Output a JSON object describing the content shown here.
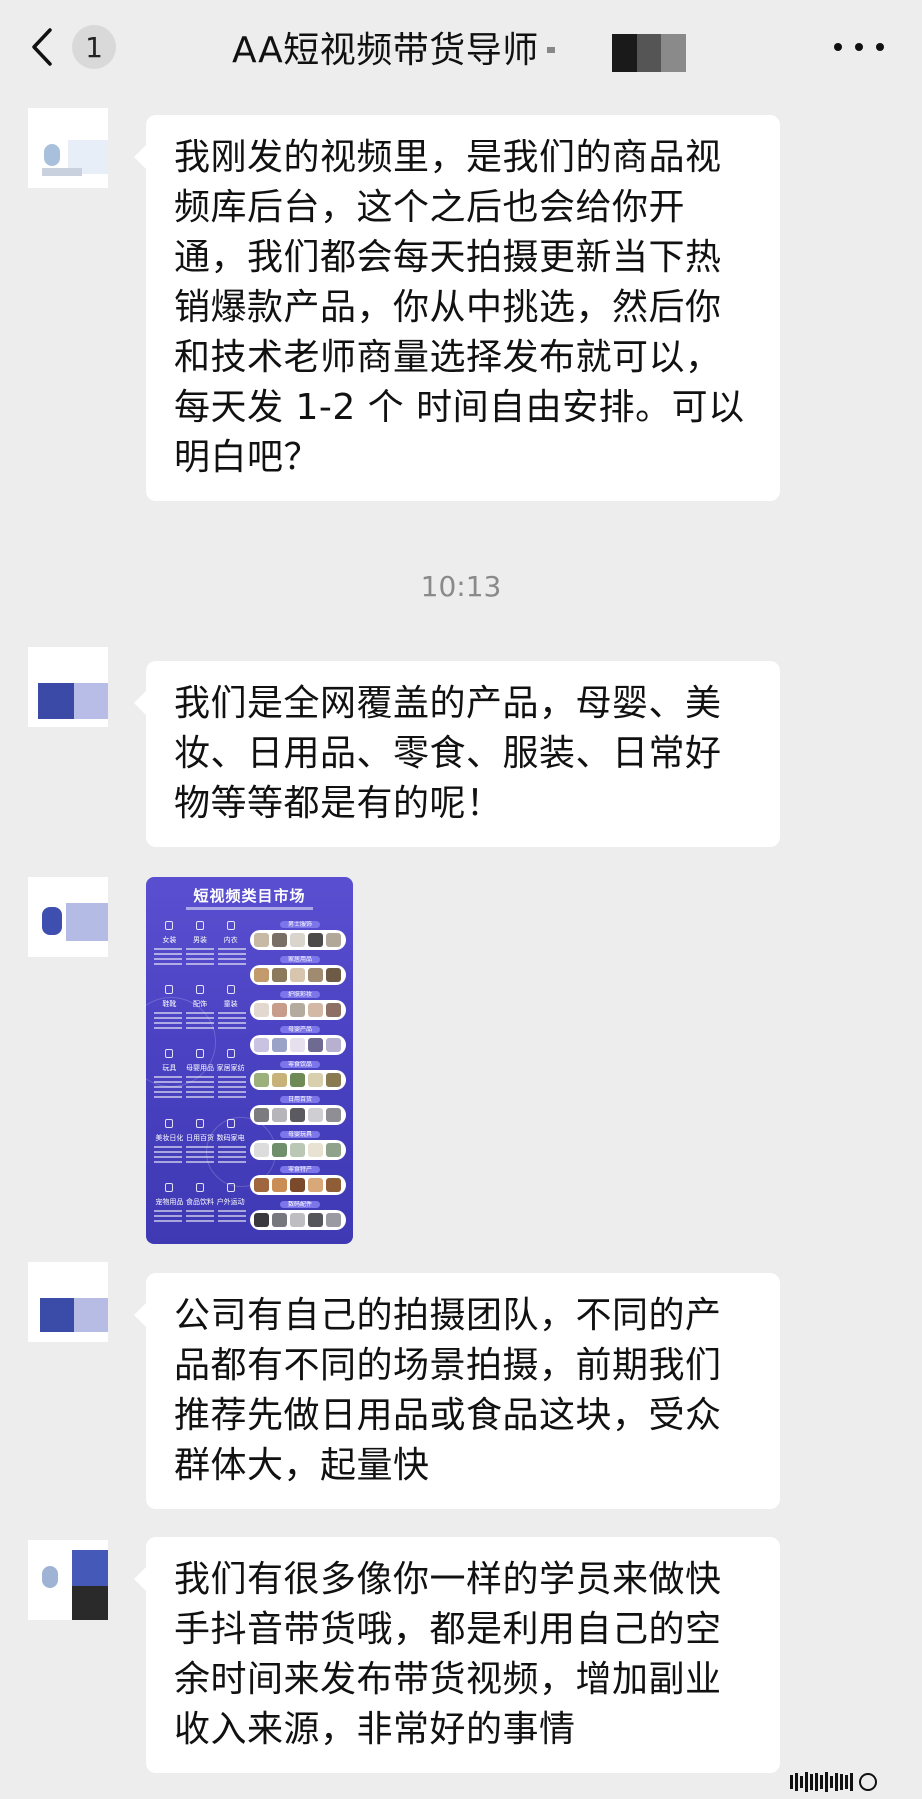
{
  "header": {
    "back_icon": "chevron-left-icon",
    "unread_count": "1",
    "title": "AA短视频带货导师",
    "more_icon": "ellipsis-icon",
    "redact_colors": [
      "#1a1a1a",
      "#555555",
      "#8a8a8a"
    ]
  },
  "messages": [
    {
      "sender": "incoming",
      "text": "我刚发的视频里，是我们的商品视频库后台，这个之后也会给你开通，我们都会每天拍摄更新当下热销爆款产品，你从中挑选，然后你和技术老师商量选择发布就可以，每天发 1-2 个 时间自由安排。可以明白吧？"
    },
    {
      "sender": "incoming",
      "text": "我们是全网覆盖的产品，母婴、美妆、日用品、零食、服装、日常好物等等都是有的呢！"
    },
    {
      "sender": "incoming",
      "type": "image",
      "poster": {
        "title": "短视频类目市场",
        "categories": [
          [
            "女装",
            "男装",
            "内衣"
          ],
          [
            "鞋靴",
            "配饰",
            "童装"
          ],
          [
            "玩具",
            "母婴用品",
            "家居家纺"
          ],
          [
            "美妆日化",
            "日用百货",
            "数码家电"
          ],
          [
            "宠物用品",
            "食品饮料",
            "户外运动"
          ]
        ],
        "product_tags": [
          "男士服饰",
          "家居用品",
          "护肤彩妆",
          "母婴产品",
          "零食饮品",
          "日用百货",
          "母婴玩具",
          "零食特产",
          "数码配件"
        ]
      }
    },
    {
      "sender": "incoming",
      "text": "公司有自己的拍摄团队，不同的产品都有不同的场景拍摄，前期我们推荐先做日用品或食品这块，受众群体大，起量快"
    },
    {
      "sender": "incoming",
      "text": "我们有很多像你一样的学员来做快手抖音带货哦，都是利用自己的空余时间来发布带货视频，增加副业收入来源，非常好的事情"
    }
  ],
  "timestamp": "10:13",
  "colors": {
    "background": "#ededed",
    "bubble": "#ffffff",
    "poster_purple": "#4a42c2",
    "timestamp": "#8a8a8a"
  }
}
